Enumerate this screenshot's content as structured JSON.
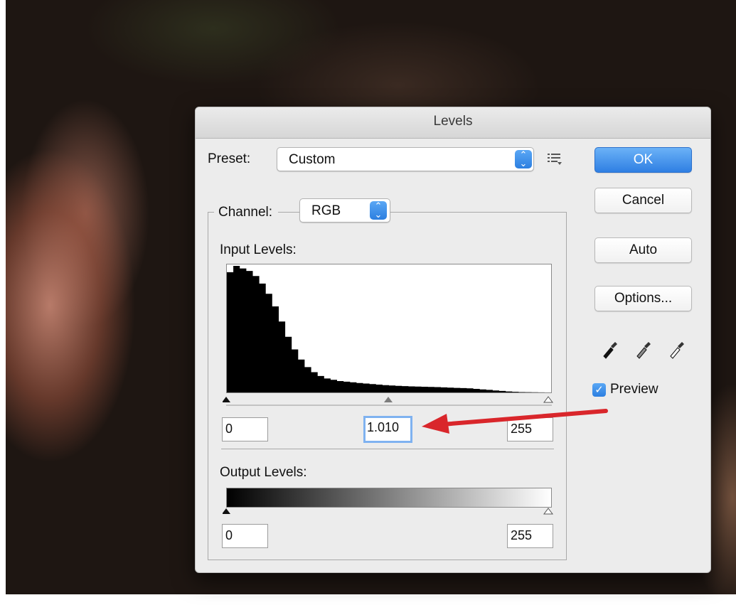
{
  "dialog": {
    "title": "Levels",
    "preset": {
      "label": "Preset:",
      "value": "Custom",
      "menu_icon": "options-list-icon"
    },
    "channel": {
      "label": "Channel:",
      "value": "RGB"
    },
    "input_levels": {
      "label": "Input Levels:",
      "black": "0",
      "gamma": "1.010",
      "white": "255"
    },
    "output_levels": {
      "label": "Output Levels:",
      "black": "0",
      "white": "255"
    },
    "buttons": {
      "ok": "OK",
      "cancel": "Cancel",
      "auto": "Auto",
      "options": "Options..."
    },
    "eyedroppers": [
      "black-point-eyedropper-icon",
      "gray-point-eyedropper-icon",
      "white-point-eyedropper-icon"
    ],
    "preview": {
      "label": "Preview",
      "checked": true
    }
  },
  "annotation": {
    "icon": "red-arrow-icon",
    "color": "#d9262b"
  },
  "histogram": {
    "type": "area",
    "x_range": [
      0,
      255
    ],
    "values": [
      0.95,
      1.0,
      0.98,
      0.96,
      0.92,
      0.86,
      0.78,
      0.68,
      0.56,
      0.44,
      0.34,
      0.26,
      0.2,
      0.16,
      0.13,
      0.11,
      0.1,
      0.09,
      0.085,
      0.08,
      0.075,
      0.07,
      0.066,
      0.062,
      0.058,
      0.055,
      0.052,
      0.05,
      0.048,
      0.046,
      0.045,
      0.044,
      0.042,
      0.04,
      0.038,
      0.036,
      0.034,
      0.032,
      0.028,
      0.024,
      0.02,
      0.016,
      0.012,
      0.008,
      0.005,
      0.003,
      0.002,
      0.001,
      0.0005,
      0.0
    ]
  }
}
